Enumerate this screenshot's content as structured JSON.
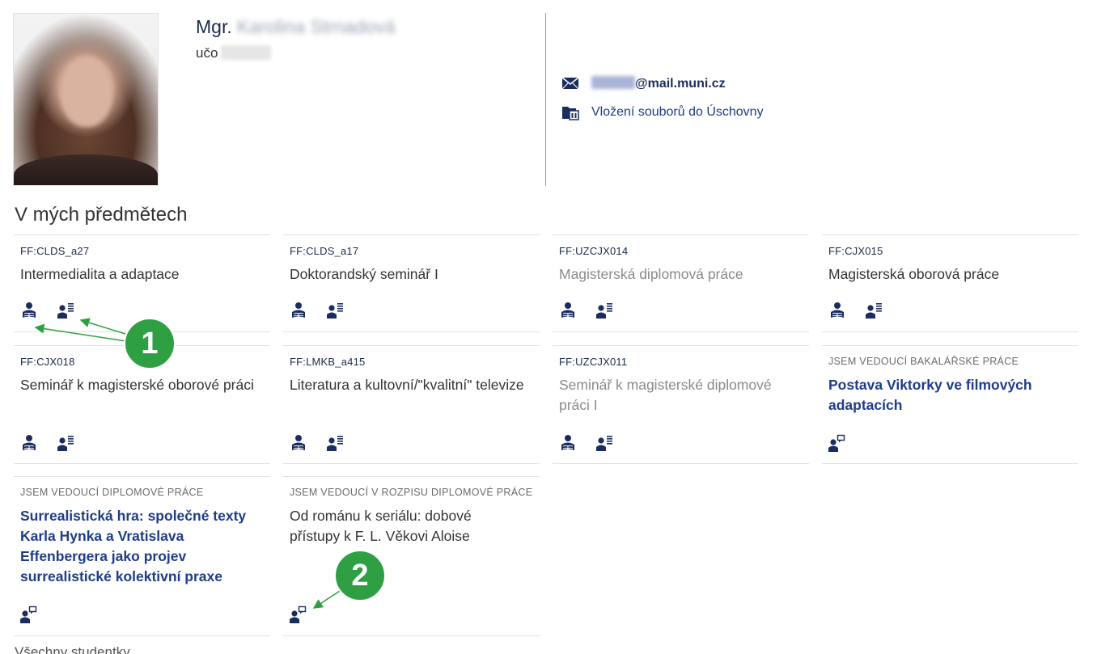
{
  "profile": {
    "title": "Mgr.",
    "name_blurred": "Karolina Strnadová",
    "uco_label": "učo",
    "email_domain": "@mail.muni.cz",
    "storage_link": "Vložení souborů do Úschovny"
  },
  "section": {
    "title": "V mých předmětech",
    "next_title": "Všechny studentky"
  },
  "cards": [
    {
      "code": "FF:CLDS_a27",
      "title": "Intermedialita a adaptace",
      "style": "normal",
      "icons": [
        "student-reading-icon",
        "person-list-icon"
      ]
    },
    {
      "code": "FF:CLDS_a17",
      "title": "Doktorandský seminář I",
      "style": "normal",
      "icons": [
        "student-reading-icon",
        "person-list-icon"
      ]
    },
    {
      "code": "FF:UZCJX014",
      "title": "Magisterská diplomová práce",
      "style": "muted",
      "icons": [
        "student-reading-icon",
        "person-list-icon"
      ]
    },
    {
      "code": "FF:CJX015",
      "title": "Magisterská oborová práce",
      "style": "normal",
      "icons": [
        "student-reading-icon",
        "person-list-icon"
      ]
    },
    {
      "code": "FF:CJX018",
      "title": "Seminář k magisterské oborové práci",
      "style": "normal",
      "icons": [
        "student-reading-icon",
        "person-list-icon"
      ]
    },
    {
      "code": "FF:LMKB_a415",
      "title": "Literatura a kultovní/\"kvalitní\" televize",
      "style": "normal",
      "icons": [
        "student-reading-icon",
        "person-list-icon"
      ]
    },
    {
      "code": "FF:UZCJX011",
      "title": "Seminář k magisterské diplomové práci I",
      "style": "muted",
      "icons": [
        "student-reading-icon",
        "person-list-icon"
      ]
    },
    {
      "code": "JSEM VEDOUCÍ BAKALÁŘSKÉ PRÁCE",
      "title": "Postava Viktorky ve filmových adaptacích",
      "style": "link",
      "icons": [
        "person-chat-icon"
      ]
    },
    {
      "code": "JSEM VEDOUCÍ DIPLOMOVÉ PRÁCE",
      "title": "Surrealistická hra: společné texty Karla Hynka a Vratislava Effenbergera jako projev surrealistické kolektivní praxe",
      "style": "link",
      "icons": [
        "person-chat-icon"
      ]
    },
    {
      "code": "JSEM VEDOUCÍ V ROZPISU DIPLOMOVÉ PRÁCE",
      "title": "Od románu k seriálu: dobové přístupy k F. L. Věkovi Aloise",
      "style": "normal",
      "icons": [
        "person-chat-icon"
      ]
    }
  ],
  "annotations": [
    "1",
    "2"
  ],
  "colors": {
    "accent": "#1f3c88",
    "icon": "#1b2c5e",
    "badge": "#2ea043"
  }
}
